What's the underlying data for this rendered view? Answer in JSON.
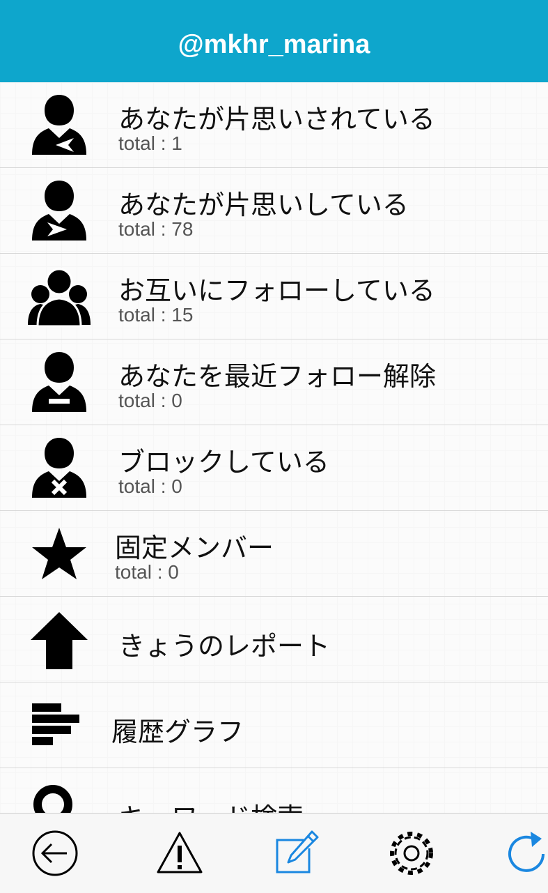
{
  "header": {
    "title": "@mkhr_marina"
  },
  "list": {
    "items": [
      {
        "icon": "person-arrow-in-icon",
        "label": "あなたが片思いされている",
        "count": "total : 1"
      },
      {
        "icon": "person-arrow-out-icon",
        "label": "あなたが片思いしている",
        "count": "total : 78"
      },
      {
        "icon": "group-icon",
        "label": "お互いにフォローしている",
        "count": "total : 15"
      },
      {
        "icon": "person-minus-icon",
        "label": "あなたを最近フォロー解除",
        "count": "total : 0"
      },
      {
        "icon": "person-block-icon",
        "label": "ブロックしている",
        "count": "total : 0"
      },
      {
        "icon": "star-icon",
        "label": "固定メンバー",
        "count": "total : 0"
      },
      {
        "icon": "up-arrow-icon",
        "label": "きょうのレポート"
      },
      {
        "icon": "bar-chart-icon",
        "label": "履歴グラフ"
      },
      {
        "icon": "search-icon",
        "label": "キーワード検索"
      }
    ]
  },
  "tabbar": {
    "items": [
      {
        "icon": "back-circle-icon"
      },
      {
        "icon": "warning-icon"
      },
      {
        "icon": "compose-icon"
      },
      {
        "icon": "gear-icon"
      },
      {
        "icon": "refresh-icon"
      }
    ],
    "accent": "#1a87e0"
  },
  "colors": {
    "header": "#0ea6cc"
  }
}
